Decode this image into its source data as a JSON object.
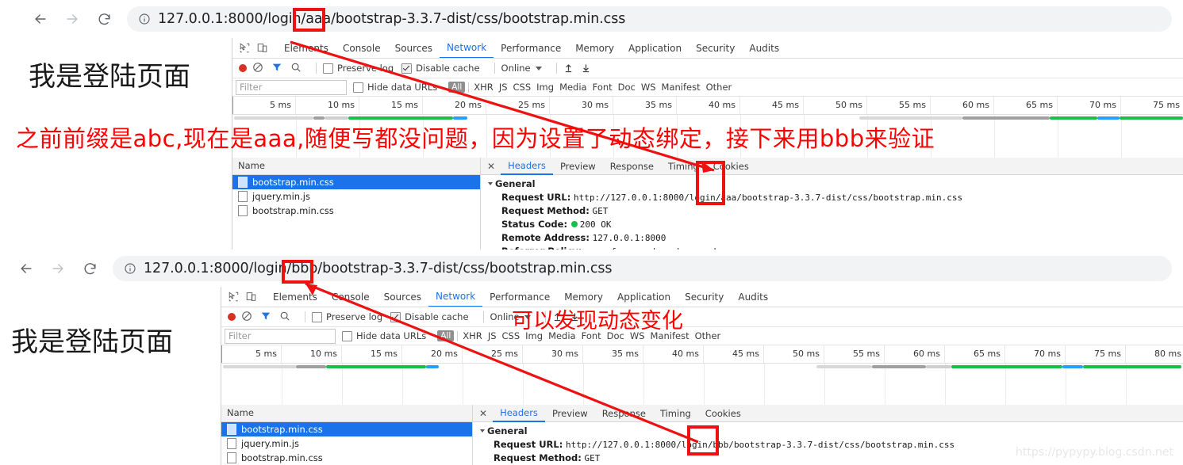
{
  "watermark": "https://pypypy.blog.csdn.net",
  "windows": [
    {
      "id": "top",
      "url_prefix": "127.0.0.1:8000/login/",
      "url_highlight": "aaa",
      "url_suffix": "/bootstrap-3.3.7-dist/css/bootstrap.min.css",
      "page_heading": "我是登陆页面",
      "annotation": "之前前缀是abc,现在是aaa,随便写都没问题，因为设置了动态绑定，接下来用bbb来验证",
      "devtools": {
        "tabs": [
          "Elements",
          "Console",
          "Sources",
          "Network",
          "Performance",
          "Memory",
          "Application",
          "Security",
          "Audits"
        ],
        "active_tab": "Network",
        "toolbar": {
          "preserve_log": "Preserve log",
          "preserve_log_checked": false,
          "disable_cache": "Disable cache",
          "disable_cache_checked": true,
          "throttling": "Online"
        },
        "filter_placeholder": "Filter",
        "hide_data_urls": "Hide data URLs",
        "hide_data_urls_checked": false,
        "types": [
          "All",
          "XHR",
          "JS",
          "CSS",
          "Img",
          "Media",
          "Font",
          "Doc",
          "WS",
          "Manifest",
          "Other"
        ],
        "active_type": "All",
        "ruler_ticks": [
          "5 ms",
          "10 ms",
          "15 ms",
          "20 ms",
          "25 ms",
          "30 ms",
          "35 ms",
          "40 ms",
          "45 ms",
          "50 ms",
          "55 ms",
          "60 ms",
          "65 ms",
          "70 ms",
          "75 ms"
        ],
        "name_column": "Name",
        "requests": [
          {
            "name": "bootstrap.min.css",
            "selected": true
          },
          {
            "name": "jquery.min.js",
            "selected": false
          },
          {
            "name": "bootstrap.min.css",
            "selected": false
          }
        ],
        "detail_tabs": [
          "Headers",
          "Preview",
          "Response",
          "Timing",
          "Cookies"
        ],
        "detail_active_tab": "Headers",
        "general_label": "General",
        "general": [
          {
            "key": "Request URL:",
            "value_pre": "http://127.0.0.1:8000/login",
            "value_hl": "/aaa/",
            "value_post": "bootstrap-3.3.7-dist/css/bootstrap.min.css"
          },
          {
            "key": "Request Method:",
            "value": "GET"
          },
          {
            "key": "Status Code:",
            "value": "200 OK",
            "dot": true
          },
          {
            "key": "Remote Address:",
            "value": "127.0.0.1:8000"
          },
          {
            "key": "Referrer Policy:",
            "value": "no-referrer-when-downgrade"
          }
        ]
      }
    },
    {
      "id": "bottom",
      "url_prefix": "127.0.0.1:8000/login/",
      "url_highlight": "bbb",
      "url_suffix": "/bootstrap-3.3.7-dist/css/bootstrap.min.css",
      "page_heading": "我是登陆页面",
      "annotation": "可以发现动态变化",
      "devtools": {
        "tabs": [
          "Elements",
          "Console",
          "Sources",
          "Network",
          "Performance",
          "Memory",
          "Application",
          "Security",
          "Audits"
        ],
        "active_tab": "Network",
        "toolbar": {
          "preserve_log": "Preserve log",
          "preserve_log_checked": false,
          "disable_cache": "Disable cache",
          "disable_cache_checked": true,
          "throttling": "Online"
        },
        "filter_placeholder": "Filter",
        "hide_data_urls": "Hide data URLs",
        "hide_data_urls_checked": false,
        "types": [
          "All",
          "XHR",
          "JS",
          "CSS",
          "Img",
          "Media",
          "Font",
          "Doc",
          "WS",
          "Manifest",
          "Other"
        ],
        "active_type": "All",
        "ruler_ticks": [
          "5 ms",
          "10 ms",
          "15 ms",
          "20 ms",
          "25 ms",
          "30 ms",
          "35 ms",
          "40 ms",
          "45 ms",
          "50 ms",
          "55 ms",
          "60 ms",
          "65 ms",
          "70 ms",
          "75 ms",
          "80 ms"
        ],
        "name_column": "Name",
        "requests": [
          {
            "name": "bootstrap.min.css",
            "selected": true
          },
          {
            "name": "jquery.min.js",
            "selected": false
          },
          {
            "name": "bootstrap.min.css",
            "selected": false
          }
        ],
        "detail_tabs": [
          "Headers",
          "Preview",
          "Response",
          "Timing",
          "Cookies"
        ],
        "detail_active_tab": "Headers",
        "general_label": "General",
        "general": [
          {
            "key": "Request URL:",
            "value_pre": "http://127.0.0.1:8000/login",
            "value_hl": "/bbb/",
            "value_post": "bootstrap-3.3.7-dist/css/bootstrap.min.css"
          },
          {
            "key": "Request Method:",
            "value": "GET"
          }
        ]
      }
    }
  ],
  "colors": {
    "accent": "#1a73e8",
    "annotation_red": "#ff0000",
    "highlight_box": "#ee1111",
    "status_green": "#18bf4a",
    "record_red": "#d93025"
  }
}
